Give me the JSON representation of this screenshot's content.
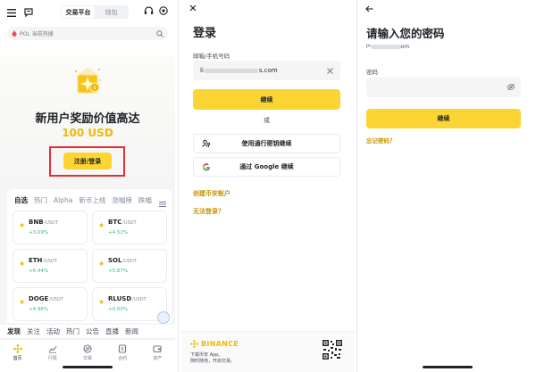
{
  "home": {
    "top_tabs": [
      "交易平台",
      "钱包"
    ],
    "search_placeholder": "POL 当前热搜",
    "promo": {
      "title": "新用户奖励价值高达",
      "amount": "100 USD",
      "register_button": "注册/登录"
    },
    "market_tabs": [
      "自选",
      "热门",
      "Alpha",
      "新币上线",
      "涨幅榜",
      "跌幅"
    ],
    "coins": [
      {
        "symbol": "BNB",
        "quote": "/USDT",
        "change": "+3.09%"
      },
      {
        "symbol": "BTC",
        "quote": "/USDT",
        "change": "+4.52%"
      },
      {
        "symbol": "ETH",
        "quote": "/USDT",
        "change": "+6.44%"
      },
      {
        "symbol": "SOL",
        "quote": "/USDT",
        "change": "+5.87%"
      },
      {
        "symbol": "DOGE",
        "quote": "/USDT",
        "change": "+4.96%"
      },
      {
        "symbol": "RLUSD",
        "quote": "/USDT",
        "change": "+0.03%"
      }
    ],
    "feed_tabs": [
      "发现",
      "关注",
      "活动",
      "热门",
      "公告",
      "直播",
      "新闻"
    ],
    "nav": [
      {
        "label": "首页",
        "icon": "binance-logo-icon"
      },
      {
        "label": "行情",
        "icon": "chart-icon"
      },
      {
        "label": "交易",
        "icon": "trade-icon"
      },
      {
        "label": "合约",
        "icon": "futures-icon"
      },
      {
        "label": "资产",
        "icon": "wallet-icon"
      }
    ]
  },
  "login": {
    "title": "登录",
    "email_label": "邮箱/手机号码",
    "email_prefix": "li",
    "email_suffix": "s.com",
    "continue_label": "继续",
    "or_label": "或",
    "passkey_label": "使用通行密钥继续",
    "google_label": "通过 Google 继续",
    "create_account": "创建币安账户",
    "cant_login": "无法登录？",
    "footer": {
      "brand": "BINANCE",
      "line1": "下载币安 App。",
      "line2": "随时随地，开启交易。"
    }
  },
  "password": {
    "title": "请输入您的密码",
    "account_prefix": "l*",
    "account_suffix": "om",
    "password_label": "密码",
    "continue_label": "继续",
    "forgot_label": "忘记密码？"
  },
  "colors": {
    "accent": "#fcd535",
    "brand": "#f0b90b",
    "up": "#2ebd85",
    "link": "#c99400",
    "highlight": "#e2302f"
  }
}
